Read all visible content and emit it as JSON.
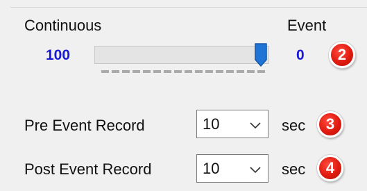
{
  "slider": {
    "left_label": "Continuous",
    "right_label": "Event",
    "left_value": "100",
    "right_value": "0",
    "position_fraction": 1.0
  },
  "pre_event": {
    "label": "Pre Event Record",
    "value": "10",
    "unit": "sec"
  },
  "post_event": {
    "label": "Post Event Record",
    "value": "10",
    "unit": "sec"
  },
  "badges": {
    "slider": "2",
    "pre_event": "3",
    "post_event": "4"
  },
  "colors": {
    "value_blue": "#1a1ad6",
    "thumb_blue": "#1f74d6",
    "badge_red": "#e01b10"
  },
  "icons": {
    "slider_thumb": "slider-thumb-icon",
    "dropdown": "chevron-down-icon"
  }
}
